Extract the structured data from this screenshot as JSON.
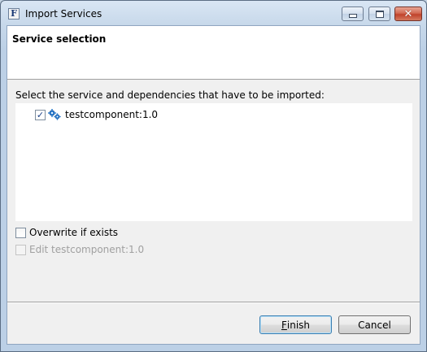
{
  "window": {
    "title": "Import Services",
    "app_icon_letter": "F",
    "controls": {
      "minimize": "minimize-icon",
      "maximize": "maximize-icon",
      "close": "close-icon"
    }
  },
  "banner": {
    "title": "Service selection"
  },
  "content": {
    "prompt": "Select the service and dependencies that have to be imported:",
    "tree_items": [
      {
        "label": "testcomponent:1.0",
        "checked": true,
        "icon": "gears-icon"
      }
    ],
    "overwrite": {
      "label": "Overwrite if exists",
      "checked": false
    },
    "edit": {
      "label": "Edit testcomponent:1.0",
      "checked": false,
      "disabled": true
    }
  },
  "buttons": {
    "finish": {
      "mnemonic": "F",
      "rest": "inish"
    },
    "cancel": {
      "label": "Cancel"
    }
  },
  "colors": {
    "accent": "#3c7fb1",
    "check": "#1a3f86",
    "gear": "#2f7fd0"
  }
}
